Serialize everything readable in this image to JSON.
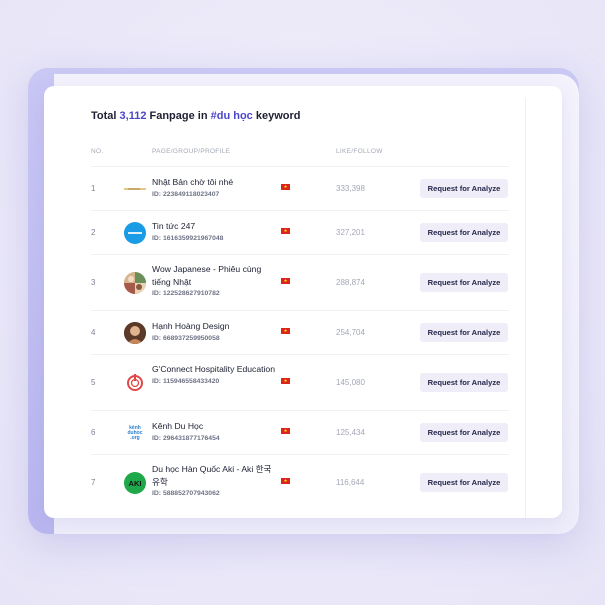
{
  "title": {
    "prefix": "Total ",
    "count": "3,112",
    "middle": " Fanpage in ",
    "keyword": "#du học",
    "suffix": " keyword"
  },
  "table": {
    "columns": {
      "no": "NO.",
      "page": "PAGE/GROUP/PROFILE",
      "likes": "LIKE/FOLLOW"
    },
    "button_label": "Request for Analyze",
    "rows": [
      {
        "no": "1",
        "name": "Nhật Bản chờ tôi nhé",
        "id": "ID: 223849118023407",
        "likes": "333,398",
        "avatar": "thin-line-logo-icon"
      },
      {
        "no": "2",
        "name": "Tin tức 247",
        "id": "ID: 1616359921967048",
        "likes": "327,201",
        "avatar": "blue-news-logo-icon"
      },
      {
        "no": "3",
        "name": "Wow Japanese - Phiêu cùng tiếng Nhật",
        "id": "ID: 122528627910782",
        "likes": "288,874",
        "avatar": "collage-photo-icon"
      },
      {
        "no": "4",
        "name": "Hạnh Hoàng Design",
        "id": "ID: 668937259950058",
        "likes": "254,704",
        "avatar": "portrait-photo-icon"
      },
      {
        "no": "5",
        "name": "G'Connect Hospitality Education",
        "id": "ID: 115946558433420",
        "likes": "145,080",
        "avatar": "power-ring-logo-icon"
      },
      {
        "no": "6",
        "name": "Kênh Du Học",
        "id": "ID: 296431877176454",
        "likes": "125,434",
        "avatar": "kenhduhoc-logo-icon",
        "avatar_text": "kênh duhoc .org"
      },
      {
        "no": "7",
        "name": "Du học Hàn Quốc Aki - Aki 한국 유학",
        "id": "ID: 588852707943062",
        "likes": "116,644",
        "avatar": "aki-logo-icon",
        "avatar_text": "AKI"
      }
    ]
  },
  "colors": {
    "accent": "#4b46c8",
    "button_bg": "#eeedf8",
    "flag_red": "#da251d",
    "flag_star": "#ffdd00"
  }
}
